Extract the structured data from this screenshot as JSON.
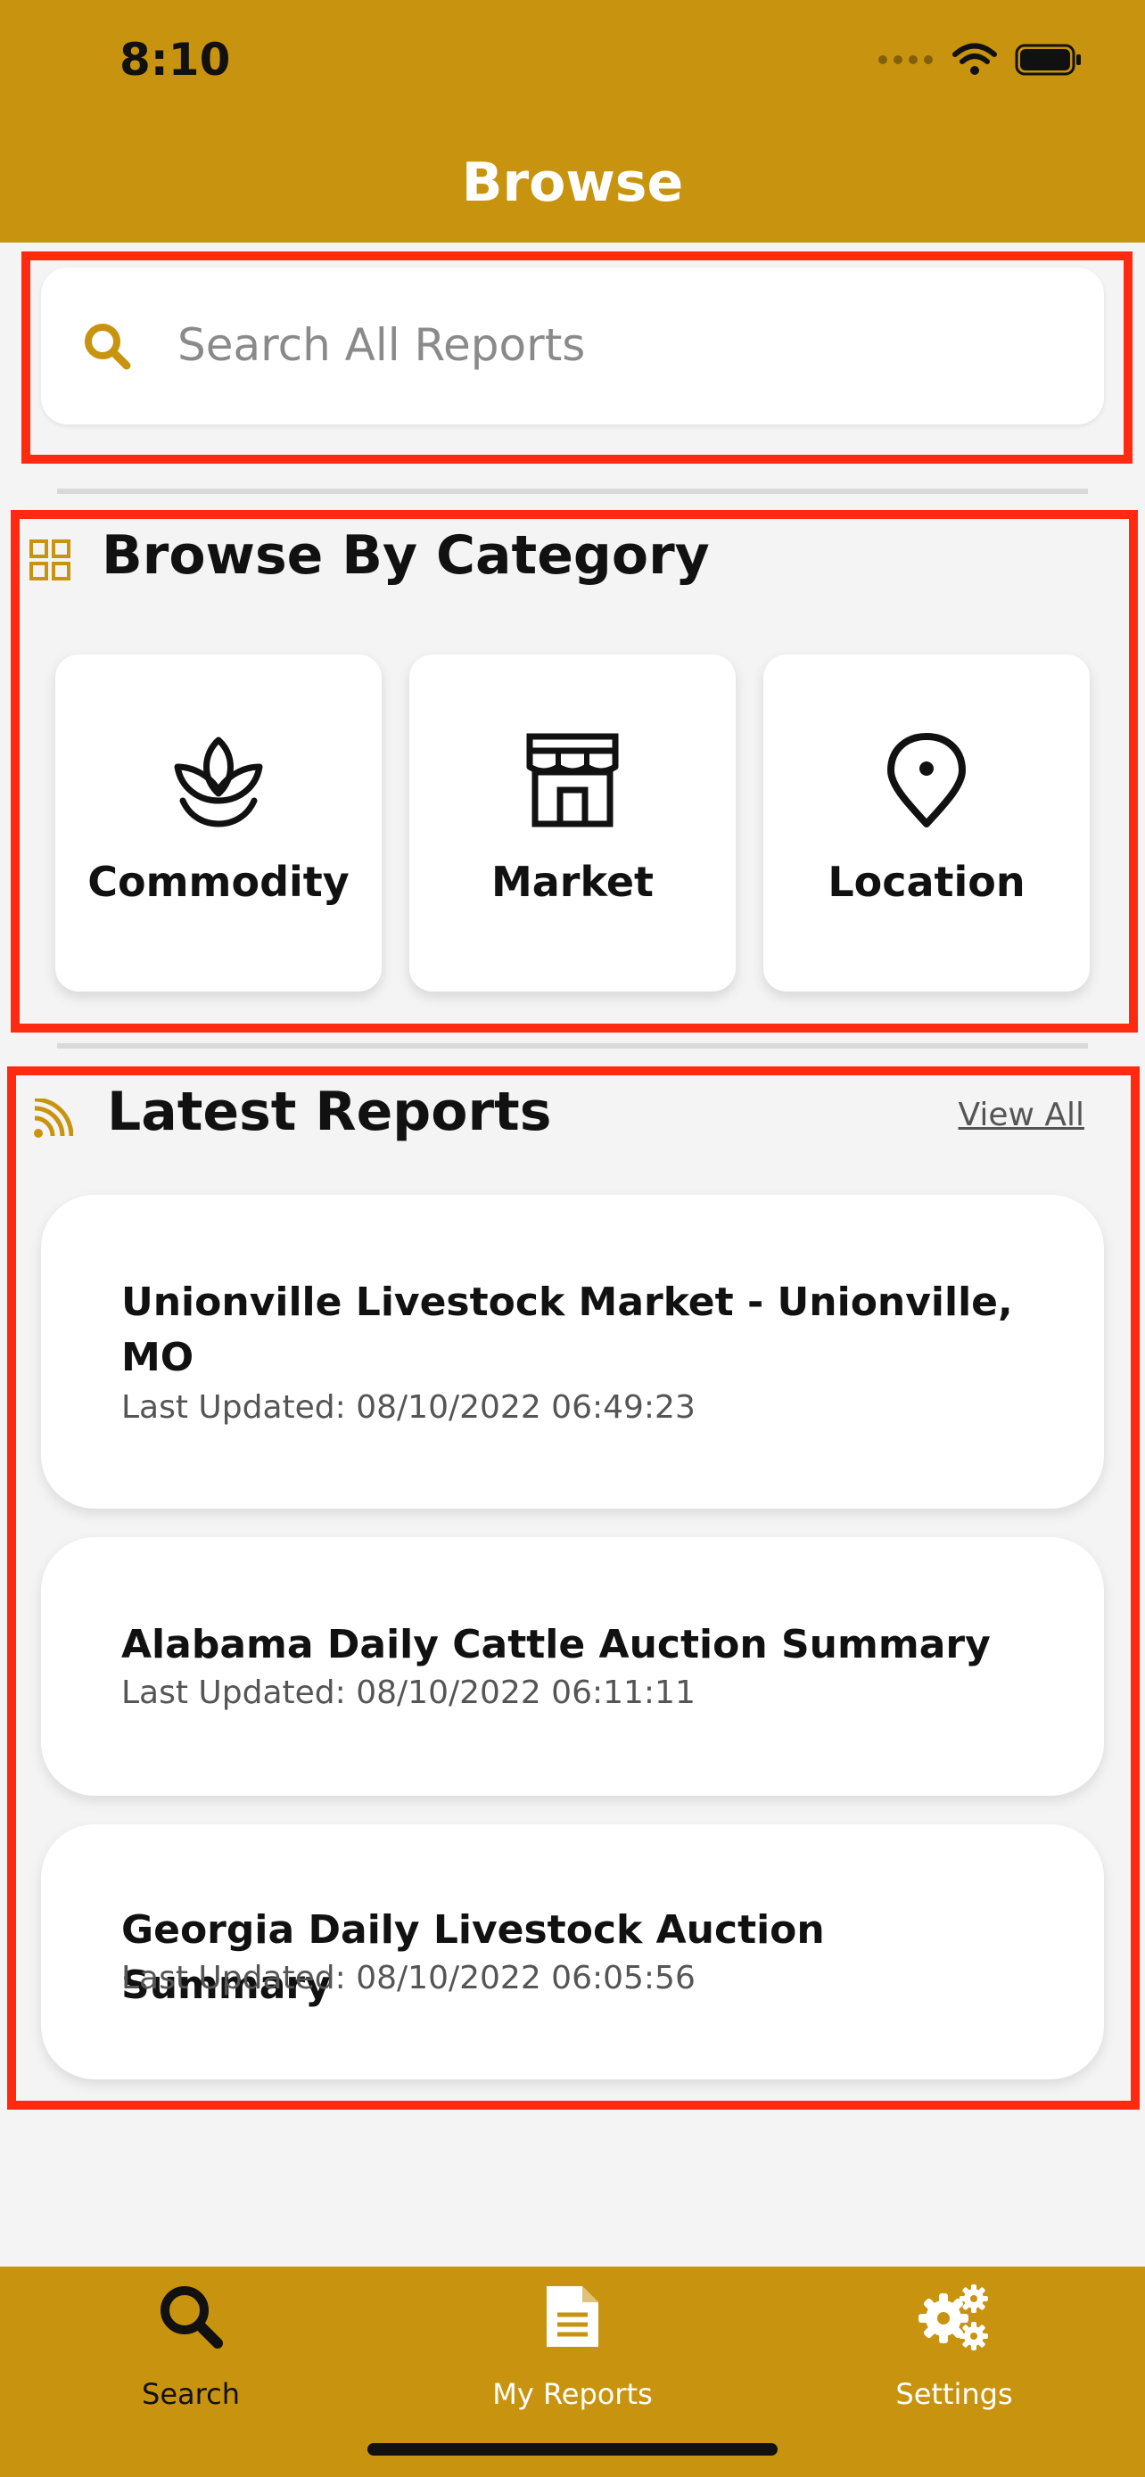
{
  "status_bar": {
    "time": "8:10"
  },
  "header": {
    "title": "Browse"
  },
  "search": {
    "placeholder": "Search All Reports"
  },
  "categories": {
    "title": "Browse By Category",
    "items": [
      {
        "label": "Commodity",
        "icon": "leaf-icon"
      },
      {
        "label": "Market",
        "icon": "storefront-icon"
      },
      {
        "label": "Location",
        "icon": "map-pin-icon"
      }
    ]
  },
  "latest": {
    "title": "Latest Reports",
    "view_all": "View All",
    "reports": [
      {
        "title": "Unionville Livestock Market  - Unionville, MO",
        "updated": "Last Updated: 08/10/2022 06:49:23"
      },
      {
        "title": "Alabama Daily Cattle Auction Summary",
        "updated": "Last Updated: 08/10/2022 06:11:11"
      },
      {
        "title": "Georgia Daily Livestock Auction Summary",
        "updated": "Last Updated: 08/10/2022 06:05:56"
      }
    ]
  },
  "tabbar": {
    "items": [
      {
        "label": "Search",
        "icon": "search-icon",
        "active": true
      },
      {
        "label": "My Reports",
        "icon": "document-icon",
        "active": false
      },
      {
        "label": "Settings",
        "icon": "gears-icon",
        "active": false
      }
    ]
  },
  "colors": {
    "brand": "#c8940f",
    "annotation_red": "#ff2a10",
    "background": "#f4f4f4"
  }
}
